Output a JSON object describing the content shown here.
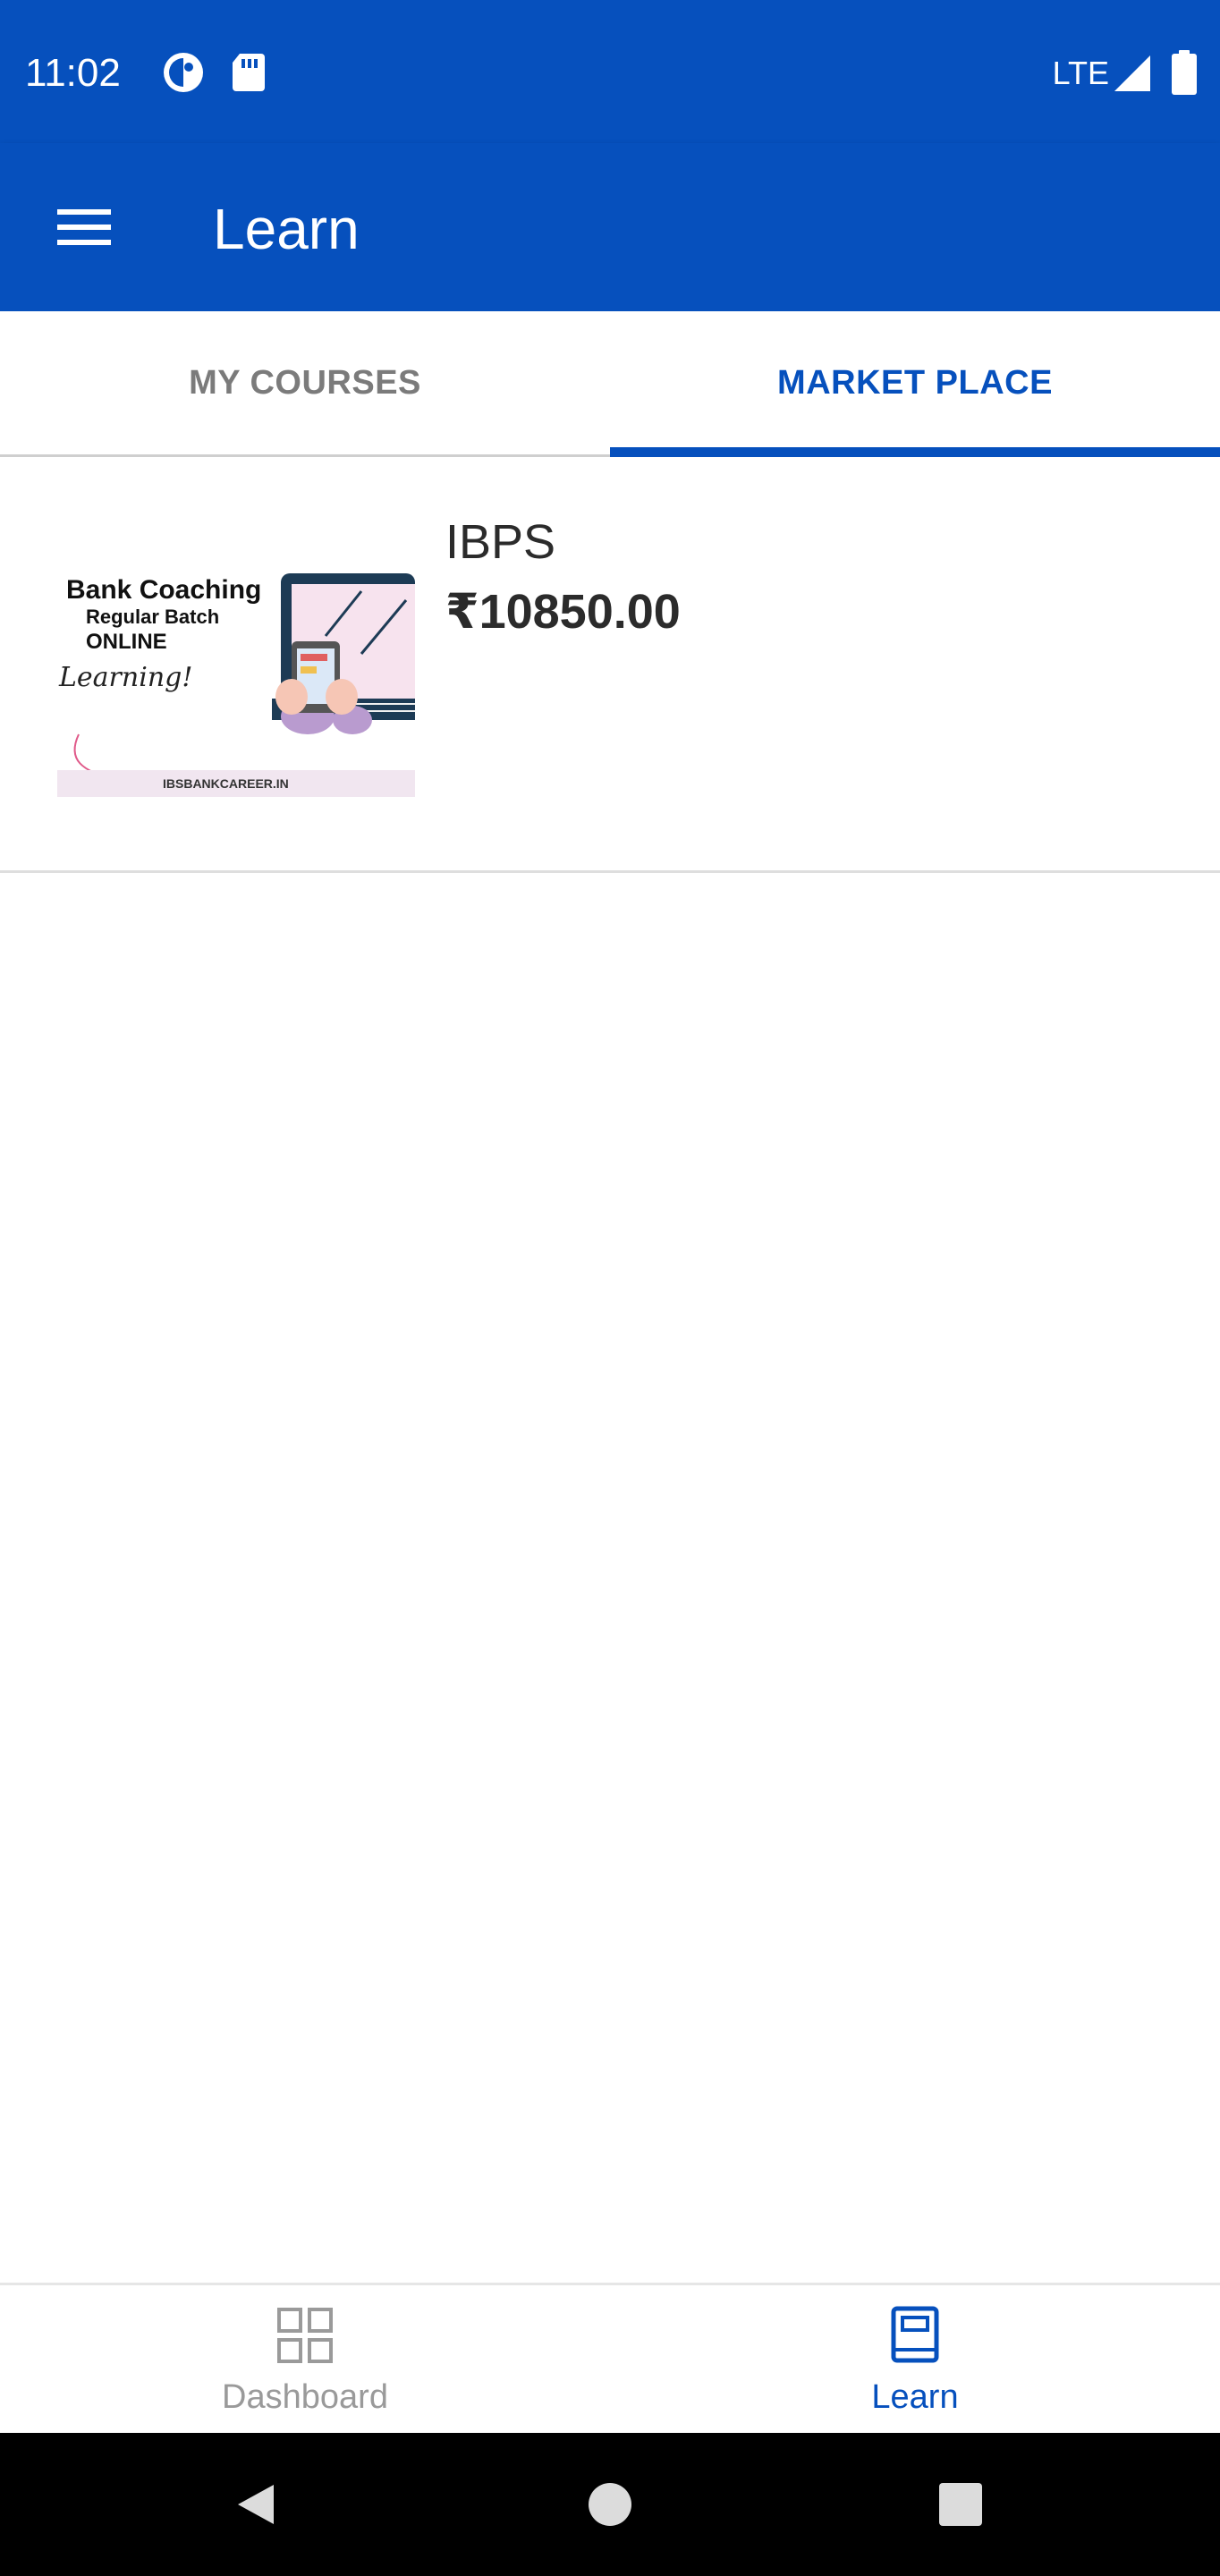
{
  "status_bar": {
    "time": "11:02",
    "network": "LTE",
    "icons": [
      "data-saver-icon",
      "sd-card-icon",
      "signal-icon",
      "battery-icon"
    ]
  },
  "app_bar": {
    "title": "Learn",
    "menu_icon": "hamburger-menu-icon"
  },
  "tabs": [
    {
      "label": "MY COURSES",
      "selected": false
    },
    {
      "label": "MARKET PLACE",
      "selected": true
    }
  ],
  "courses": [
    {
      "title": "IBPS",
      "price": "₹10850.00",
      "thumbnail": {
        "heading": "Bank Coaching",
        "subheading": "Regular Batch",
        "tag": "ONLINE",
        "script": "Learning!",
        "website": "IBSBANKCAREER.IN"
      }
    }
  ],
  "bottom_nav": [
    {
      "label": "Dashboard",
      "icon": "dashboard-grid-icon",
      "selected": false
    },
    {
      "label": "Learn",
      "icon": "book-icon",
      "selected": true
    }
  ],
  "colors": {
    "primary": "#0650bd",
    "tab_inactive": "#7b7b7b",
    "text_dark": "#2b2b2b"
  }
}
